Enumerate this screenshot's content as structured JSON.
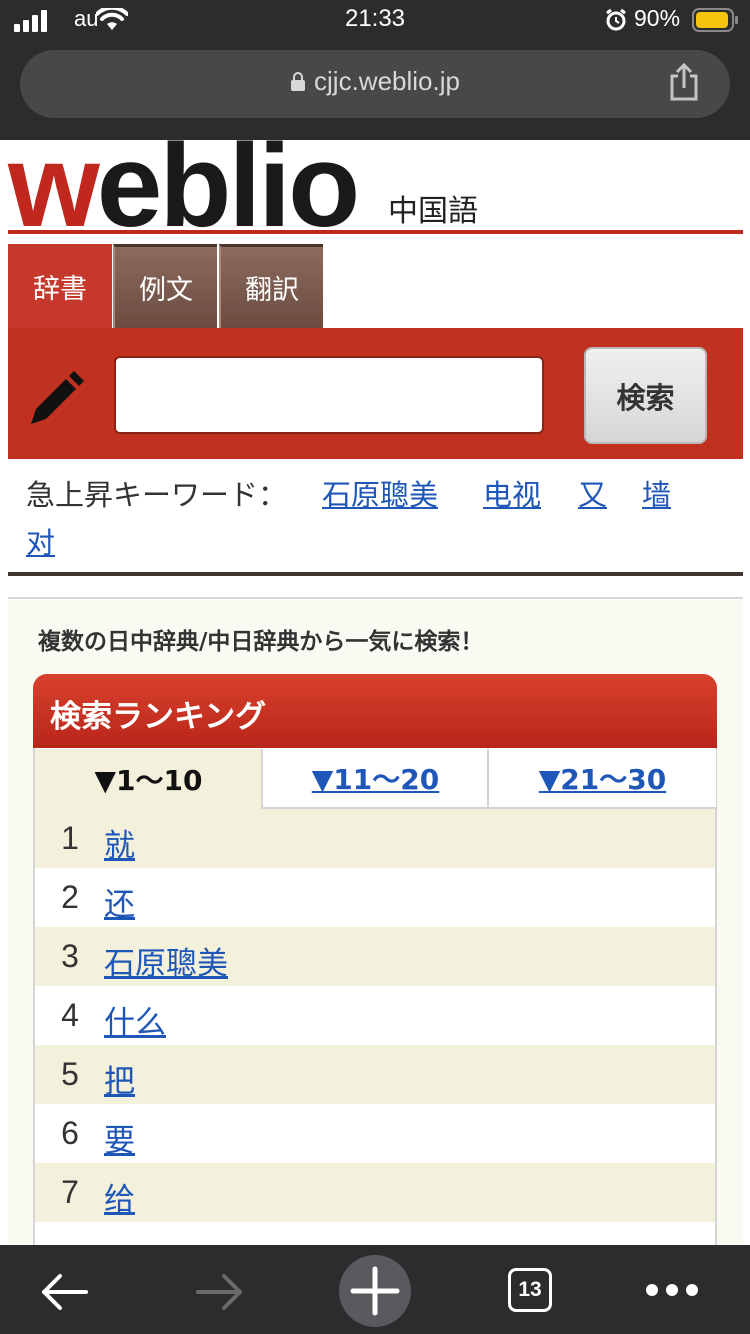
{
  "status_bar": {
    "carrier": "au",
    "time": "21:33",
    "battery": "90%"
  },
  "browser": {
    "url": "cjjc.weblio.jp",
    "tab_count": "13"
  },
  "header": {
    "logo_w": "w",
    "logo_rest": "eblio",
    "section": "中国語"
  },
  "tabs": [
    {
      "label": "辞書"
    },
    {
      "label": "例文"
    },
    {
      "label": "翻訳"
    }
  ],
  "search": {
    "value": "",
    "placeholder": "",
    "button_label": "検索"
  },
  "trending": {
    "label": "急上昇キーワード：",
    "keywords": [
      "石原聰美",
      "电视",
      "又",
      "墙",
      "对"
    ]
  },
  "tagline": "複数の日中辞典/中日辞典から一気に検索！",
  "ranking": {
    "title": "検索ランキング",
    "tabs": [
      "▼1〜10",
      "▼11〜20",
      "▼21〜30"
    ],
    "items": [
      {
        "rank": "1",
        "word": "就"
      },
      {
        "rank": "2",
        "word": "还"
      },
      {
        "rank": "3",
        "word": "石原聰美"
      },
      {
        "rank": "4",
        "word": "什么"
      },
      {
        "rank": "5",
        "word": "把"
      },
      {
        "rank": "6",
        "word": "要"
      },
      {
        "rank": "7",
        "word": "给"
      }
    ]
  },
  "colors": {
    "brand_red": "#c0281e",
    "link_blue": "#1f57b8",
    "row_alt": "#f3f1dc"
  }
}
